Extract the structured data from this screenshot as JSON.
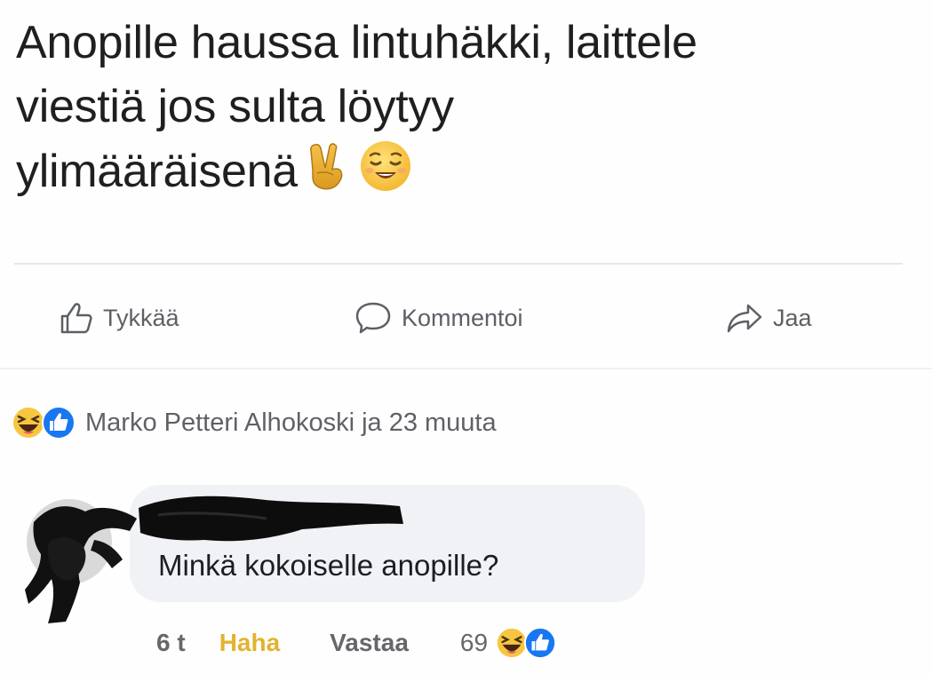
{
  "post": {
    "lines": [
      "Anopille haussa lintuhäkki, laittele",
      "viestiä jos sulta löytyy",
      "ylimääräisenä"
    ],
    "emojis": [
      "victory-hand-icon",
      "relieved-face-icon"
    ]
  },
  "actions": {
    "like_label": "Tykkää",
    "comment_label": "Kommentoi",
    "share_label": "Jaa"
  },
  "reactions": {
    "icons": [
      "haha-reaction-icon",
      "like-reaction-icon"
    ],
    "summary": "Marko Petteri Alhokoski ja 23 muuta"
  },
  "comment": {
    "author_redacted": true,
    "text": "Minkä kokoiselle anopille?",
    "time": "6 t",
    "reaction_label": "Haha",
    "reply_label": "Vastaa",
    "reaction_count": "69"
  },
  "colors": {
    "haha_active": "#e2b330",
    "muted_text": "#65676b",
    "bubble_bg": "#f0f2f5",
    "like_blue": "#1877f2",
    "haha_yellow": "#f7c640"
  }
}
